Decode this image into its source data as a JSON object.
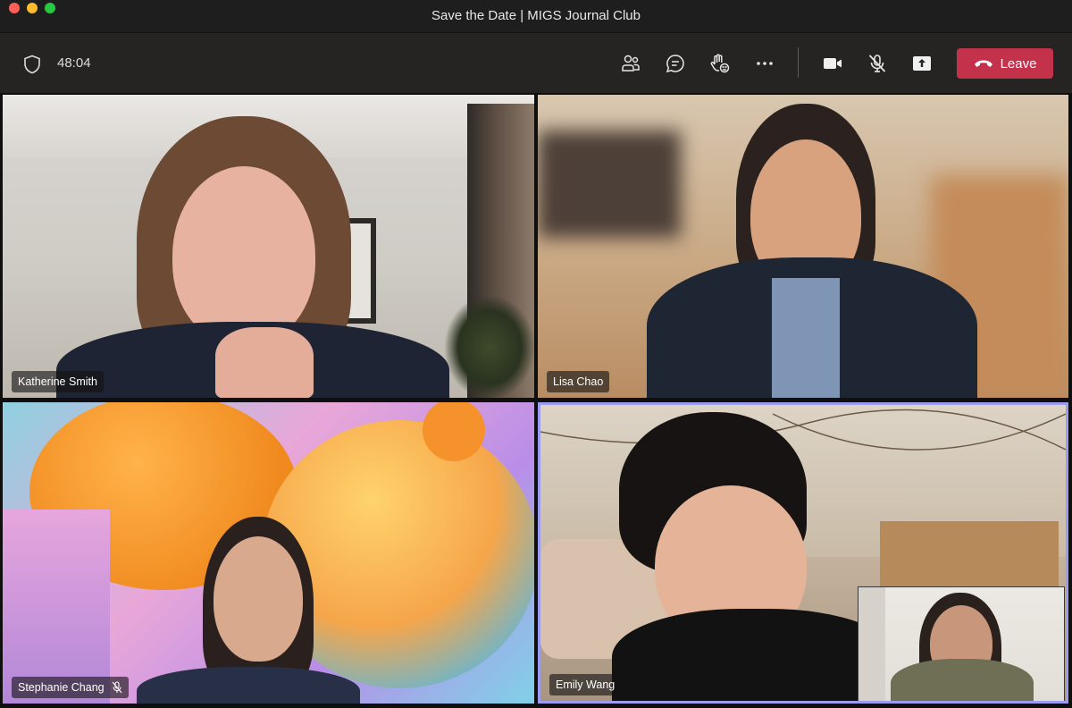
{
  "window": {
    "title": "Save the Date | MIGS Journal Club"
  },
  "toolbar": {
    "timer": "48:04",
    "icons": [
      "shield-icon",
      "participants-icon",
      "chat-icon",
      "raise-hand-icon",
      "more-icon",
      "camera-icon",
      "mic-off-icon",
      "share-screen-icon"
    ],
    "leave_label": "Leave",
    "leave_color": "#c4314b"
  },
  "participants": [
    {
      "name": "Katherine Smith",
      "muted": false
    },
    {
      "name": "Lisa Chao",
      "muted": false
    },
    {
      "name": "Stephanie Chang",
      "muted": true
    },
    {
      "name": "Emily Wang",
      "muted": false,
      "active_speaker": true
    }
  ],
  "colors": {
    "active_border": "#9b9bf0",
    "background": "#0f0f0f"
  }
}
